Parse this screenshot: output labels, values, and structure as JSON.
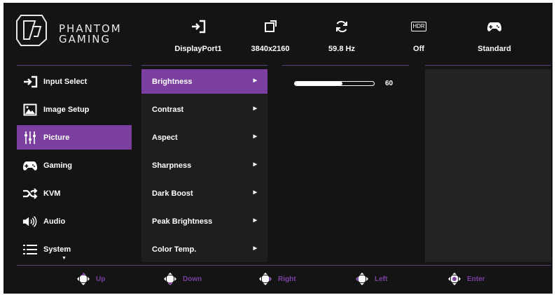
{
  "brand": {
    "line1": "PHANTOM",
    "line2": "GAMING"
  },
  "status": [
    {
      "icon": "input-icon",
      "value": "DisplayPort1"
    },
    {
      "icon": "resolution-icon",
      "value": "3840x2160"
    },
    {
      "icon": "refresh-icon",
      "value": "59.8 Hz"
    },
    {
      "icon": "hdr-icon",
      "badge": "HDR",
      "value": "Off"
    },
    {
      "icon": "gamepad-icon",
      "value": "Standard"
    }
  ],
  "menu": [
    {
      "icon": "input-select-icon",
      "label": "Input Select",
      "active": false
    },
    {
      "icon": "image-icon",
      "label": "Image Setup",
      "active": false
    },
    {
      "icon": "sliders-icon",
      "label": "Picture",
      "active": true
    },
    {
      "icon": "gamepad-icon",
      "label": "Gaming",
      "active": false
    },
    {
      "icon": "shuffle-icon",
      "label": "KVM",
      "active": false
    },
    {
      "icon": "speaker-icon",
      "label": "Audio",
      "active": false
    },
    {
      "icon": "list-icon",
      "label": "System",
      "active": false
    }
  ],
  "submenu": [
    {
      "label": "Brightness",
      "active": true
    },
    {
      "label": "Contrast",
      "active": false
    },
    {
      "label": "Aspect",
      "active": false
    },
    {
      "label": "Sharpness",
      "active": false
    },
    {
      "label": "Dark Boost",
      "active": false
    },
    {
      "label": "Peak Brightness",
      "active": false
    },
    {
      "label": "Color Temp.",
      "active": false
    }
  ],
  "slider": {
    "value": "60",
    "fraction": 0.6
  },
  "footer": [
    {
      "icon": "dpad-up-icon",
      "label": "Up"
    },
    {
      "icon": "dpad-down-icon",
      "label": "Down"
    },
    {
      "icon": "dpad-right-icon",
      "label": "Right"
    },
    {
      "icon": "dpad-left-icon",
      "label": "Left"
    },
    {
      "icon": "dpad-center-icon",
      "label": "Enter"
    }
  ],
  "colors": {
    "accent": "#7b3fa0",
    "background": "#141414",
    "panel": "#1e1e1e",
    "preview": "#232323"
  }
}
